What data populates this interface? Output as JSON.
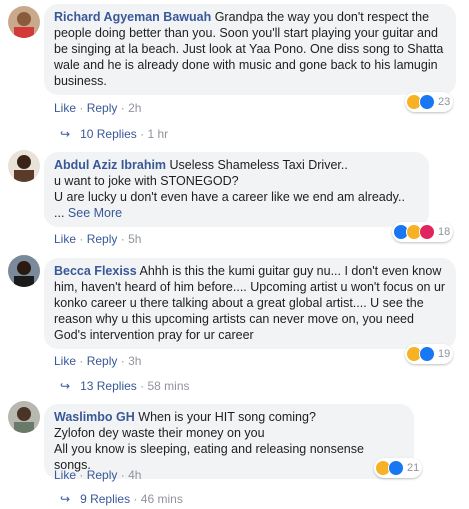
{
  "comments": [
    {
      "author": "Richard Agyeman Bawuah",
      "text": "Grandpa the way you don't respect the people doing better than you. Soon you'll start playing your guitar and be singing at la beach. Just look at Yaa Pono. One diss song to Shatta wale and he is already done with music and gone back to his lamugin business.",
      "like": "Like",
      "reply": "Reply",
      "time": "2h",
      "reaction_count": "23",
      "reactions": [
        "haha-icon",
        "like-icon"
      ],
      "replies_label": "10 Replies",
      "replies_time": "1 hr"
    },
    {
      "author": "Abdul Aziz Ibrahim",
      "text_lines": [
        "Useless Shameless Taxi Driver..",
        "u want to joke with STONEGOD?",
        "U are lucky u don't even have a career like we end am already.."
      ],
      "see_more_prefix": "...",
      "see_more": "See More",
      "like": "Like",
      "reply": "Reply",
      "time": "5h",
      "reaction_count": "18",
      "reactions": [
        "like-icon",
        "haha-icon",
        "love-icon"
      ]
    },
    {
      "author": "Becca Flexiss",
      "text": "Ahhh is this the kumi guitar guy nu... I don't even know him, haven't heard of him before.... Upcoming artist u won't focus on ur konko career u there talking about a great global artist.... U see the reason why u this upcoming artists can never move on, you need God's intervention pray for ur career",
      "like": "Like",
      "reply": "Reply",
      "time": "3h",
      "reaction_count": "19",
      "reactions": [
        "haha-icon",
        "like-icon"
      ],
      "replies_label": "13 Replies",
      "replies_time": "58 mins"
    },
    {
      "author": "Waslimbo GH",
      "text_lines": [
        "When is your HIT song coming?",
        "Zylofon dey waste their money on you",
        "All you know is sleeping, eating and releasing nonsense songs."
      ],
      "like": "Like",
      "reply": "Reply",
      "time": "4h",
      "reaction_count": "21",
      "reactions": [
        "haha-icon",
        "like-icon"
      ],
      "replies_label": "9 Replies",
      "replies_time": "46 mins"
    }
  ]
}
